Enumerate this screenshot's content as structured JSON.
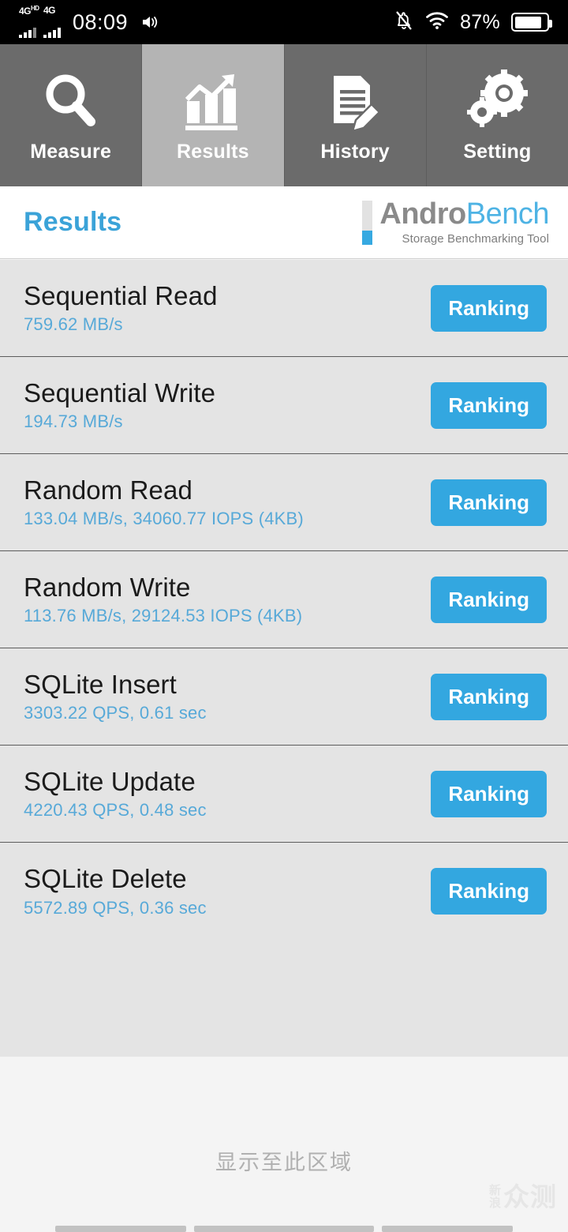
{
  "status_bar": {
    "network_1": "4G",
    "network_1_sup": "HD",
    "network_2": "4G",
    "time": "08:09",
    "volume_icon": "volume-icon",
    "mute_icon": "bell-muted-icon",
    "wifi_icon": "wifi-icon",
    "battery_percent": "87%",
    "battery_level": 87
  },
  "tabs": [
    {
      "label": "Measure",
      "icon": "magnifier-icon",
      "active": false
    },
    {
      "label": "Results",
      "icon": "bar-chart-icon",
      "active": true
    },
    {
      "label": "History",
      "icon": "document-pencil-icon",
      "active": false
    },
    {
      "label": "Setting",
      "icon": "gears-icon",
      "active": false
    }
  ],
  "header": {
    "title": "Results",
    "logo_main_1": "Andro",
    "logo_main_2": "Bench",
    "logo_sub": "Storage Benchmarking Tool"
  },
  "results": [
    {
      "title": "Sequential Read",
      "value": "759.62 MB/s",
      "button": "Ranking"
    },
    {
      "title": "Sequential Write",
      "value": "194.73 MB/s",
      "button": "Ranking"
    },
    {
      "title": "Random Read",
      "value": "133.04 MB/s, 34060.77 IOPS (4KB)",
      "button": "Ranking"
    },
    {
      "title": "Random Write",
      "value": "113.76 MB/s, 29124.53 IOPS (4KB)",
      "button": "Ranking"
    },
    {
      "title": "SQLite Insert",
      "value": "3303.22 QPS, 0.61 sec",
      "button": "Ranking"
    },
    {
      "title": "SQLite Update",
      "value": "4220.43 QPS, 0.48 sec",
      "button": "Ranking"
    },
    {
      "title": "SQLite Delete",
      "value": "5572.89 QPS, 0.36 sec",
      "button": "Ranking"
    }
  ],
  "footer": {
    "hint": "显示至此区域",
    "watermark_small_1": "新",
    "watermark_small_2": "浪",
    "watermark_big": "众测"
  },
  "colors": {
    "accent": "#33a7e0",
    "value_text": "#57a9d8",
    "tab_inactive": "#6b6b6b",
    "tab_active": "#b4b4b4",
    "list_bg": "#e4e4e4"
  }
}
